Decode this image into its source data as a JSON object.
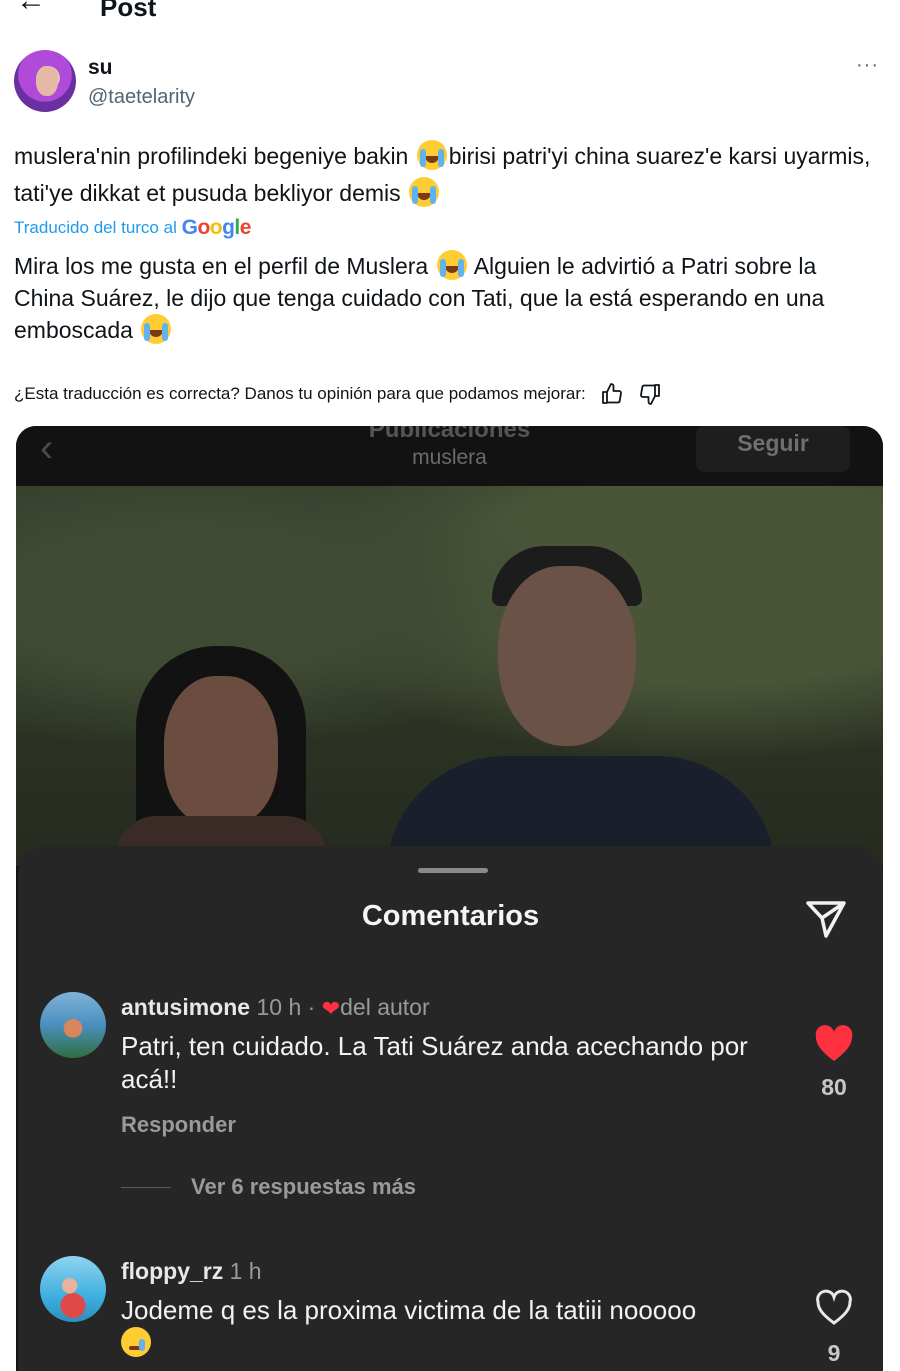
{
  "header": {
    "back_icon": "arrow-left-icon",
    "title": "Post"
  },
  "post": {
    "author_name": "su",
    "author_handle": "@taetelarity",
    "more_label": "···",
    "text_part1": "muslera'nin profilindeki begeniye bakin ",
    "text_part2": "birisi patri'yi china suarez'e karsi uyarmis, tati'ye dikkat et pusuda bekliyor demis ",
    "translated_label": "Traducido del turco al",
    "google_logo": [
      "G",
      "o",
      "o",
      "g",
      "l",
      "e"
    ],
    "translation_part1": "Mira los me gusta en el perfil de Muslera ",
    "translation_part2": " Alguien le advirtió a Patri sobre la China Suárez, le dijo que tenga cuidado con Tati, que la está esperando en una emboscada ",
    "feedback_question": "¿Esta traducción es correcta? Danos tu opinión para que podamos mejorar:",
    "emoji": "loudly-crying-face-icon"
  },
  "media": {
    "header_title": "Publicaciones",
    "header_subtitle": "muslera",
    "follow_label": "Seguir",
    "sheet_title": "Comentarios",
    "comments": [
      {
        "username": "antusimone",
        "time": " 10 h · ",
        "author_badge": "del autor",
        "text": "Patri, ten cuidado. La Tati Suárez anda acechando por acá!!",
        "reply_label": "Responder",
        "more_replies": "Ver 6 respuestas más",
        "likes": "80",
        "liked": true
      },
      {
        "username": "floppy_rz",
        "time": " 1 h",
        "text": "Jodeme q es la proxima victima de la tatiii nooooo",
        "likes": "9",
        "liked": false
      }
    ],
    "colors": {
      "like_red": "#ff3040",
      "sheet_bg": "#262626"
    }
  }
}
